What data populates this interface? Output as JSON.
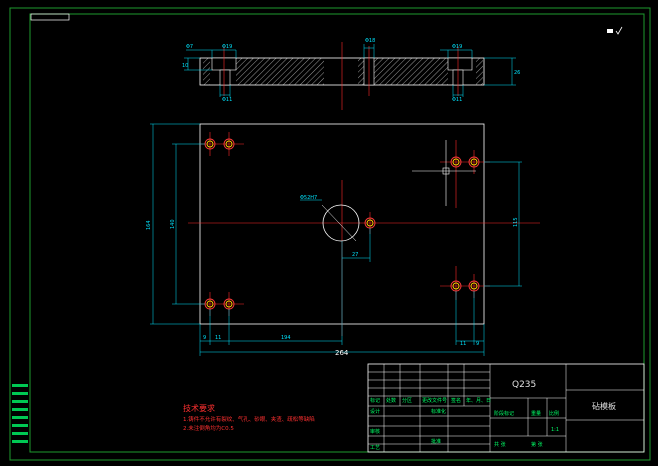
{
  "drawing": {
    "material": "Q235",
    "part_name": "砧模板",
    "scale_value": "1:1",
    "technical_requirements": {
      "title": "技术要求",
      "items": [
        "1.铸件不允许有裂纹、气孔、砂眼、夹渣、疏松等缺陷",
        "2.未注倒角均为C0.5"
      ]
    },
    "dimensions": {
      "top_view": {
        "d7": "Φ7",
        "d19_left": "Φ19",
        "d19_right": "Φ19",
        "d11_left": "Φ11",
        "d11_right": "Φ11",
        "thick_left": "10",
        "thick_right": "26",
        "center_hole": "Φ18"
      },
      "front_view": {
        "overall_width": "264",
        "height_left": "164",
        "height_inner": "140",
        "height_right": "115",
        "big_hole": "Φ52H7",
        "offset_x": "27",
        "left_edge": "9",
        "left_pitch": "11",
        "right_pitch": "11",
        "right_edge": "9",
        "base_length": "194"
      }
    },
    "title_block": {
      "row_labels": [
        "标记",
        "处数",
        "分区",
        "更改文件号",
        "签名",
        "年、月、日"
      ],
      "design": "设计",
      "standardization": "标准化",
      "review": "审核",
      "process": "工艺",
      "approve": "批准",
      "stage_mark": "阶段标记",
      "weight": "重量",
      "scale": "比例",
      "sheet_total": "共 张",
      "sheet_no": "第 张"
    }
  }
}
